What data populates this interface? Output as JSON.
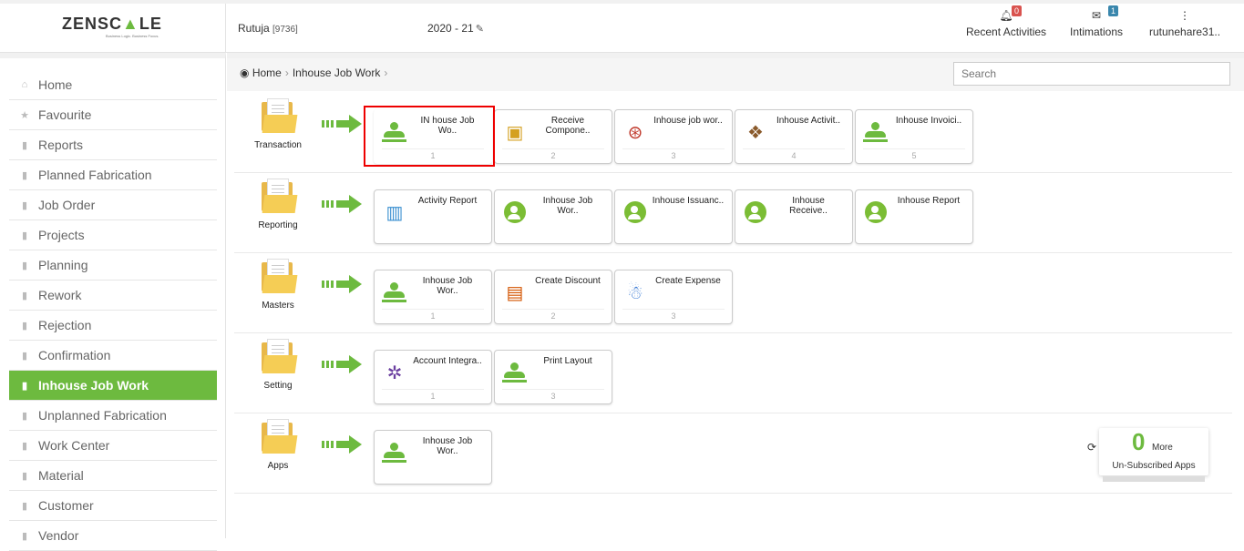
{
  "header": {
    "logo_pre": "ZENSC",
    "logo_accent": "▲",
    "logo_post": "LE",
    "tagline": "Business Logic. Business Focus.",
    "user_name": "Rutuja",
    "user_code": "[9736]",
    "year": "2020 - 21",
    "recent_label": "Recent Activities",
    "recent_count": "0",
    "intimations_label": "Intimations",
    "intimations_count": "1",
    "profile_label": "rutunehare31.."
  },
  "sidebar": {
    "items": [
      {
        "label": "Home"
      },
      {
        "label": "Favourite"
      },
      {
        "label": "Reports"
      },
      {
        "label": "Planned Fabrication"
      },
      {
        "label": "Job Order"
      },
      {
        "label": "Projects"
      },
      {
        "label": "Planning"
      },
      {
        "label": "Rework"
      },
      {
        "label": "Rejection"
      },
      {
        "label": "Confirmation"
      },
      {
        "label": "Inhouse Job Work"
      },
      {
        "label": "Unplanned Fabrication"
      },
      {
        "label": "Work Center"
      },
      {
        "label": "Material"
      },
      {
        "label": "Customer"
      },
      {
        "label": "Vendor"
      }
    ],
    "active_index": 10
  },
  "breadcrumb": {
    "home": "Home",
    "current": "Inhouse Job Work"
  },
  "search": {
    "placeholder": "Search"
  },
  "sections": [
    {
      "label": "Transaction",
      "cards": [
        {
          "title": "IN house Job Wo..",
          "num": "1"
        },
        {
          "title": "Receive Compone..",
          "num": "2"
        },
        {
          "title": "Inhouse job wor..",
          "num": "3"
        },
        {
          "title": "Inhouse Activit..",
          "num": "4"
        },
        {
          "title": "Inhouse Invoici..",
          "num": "5"
        }
      ]
    },
    {
      "label": "Reporting",
      "cards": [
        {
          "title": "Activity Report",
          "num": ""
        },
        {
          "title": "Inhouse Job Wor..",
          "num": ""
        },
        {
          "title": "Inhouse Issuanc..",
          "num": ""
        },
        {
          "title": "Inhouse Receive..",
          "num": ""
        },
        {
          "title": "Inhouse Report",
          "num": ""
        }
      ]
    },
    {
      "label": "Masters",
      "cards": [
        {
          "title": "Inhouse Job Wor..",
          "num": "1"
        },
        {
          "title": "Create Discount",
          "num": "2"
        },
        {
          "title": "Create Expense",
          "num": "3"
        }
      ]
    },
    {
      "label": "Setting",
      "cards": [
        {
          "title": "Account Integra..",
          "num": "1"
        },
        {
          "title": "Print Layout",
          "num": "3"
        }
      ]
    },
    {
      "label": "Apps",
      "cards": [
        {
          "title": "Inhouse Job Wor..",
          "num": ""
        }
      ]
    }
  ],
  "unsubscribed": {
    "count": "0",
    "more_label": "More",
    "label": "Un-Subscribed Apps"
  },
  "colors": {
    "accent": "#6dba3f",
    "highlight": "#e00000"
  }
}
